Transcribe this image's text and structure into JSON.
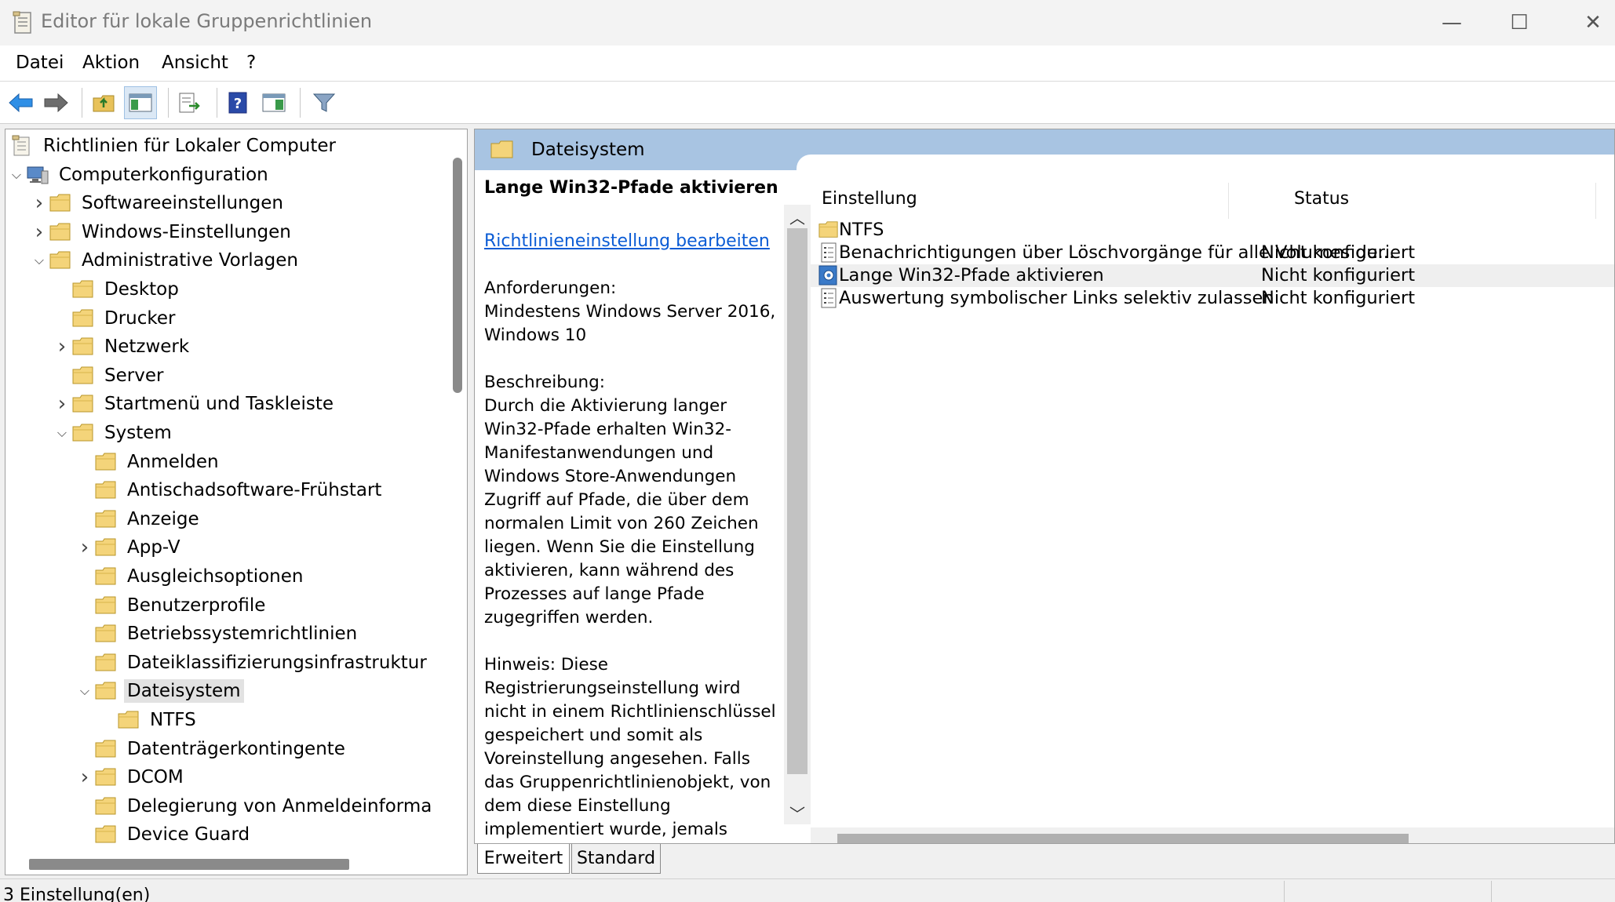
{
  "window": {
    "title": "Editor für lokale Gruppenrichtlinien",
    "minimize": "—",
    "maximize": "☐",
    "close": "✕"
  },
  "menu": [
    "Datei",
    "Aktion",
    "Ansicht",
    "?"
  ],
  "toolbar": {
    "buttons": [
      "back-icon",
      "forward-icon",
      "up-folder-icon",
      "show-hide-tree-icon",
      "export-list-icon",
      "help-icon",
      "properties-icon",
      "filter-icon"
    ]
  },
  "tree": {
    "items": [
      {
        "label": "Richtlinien für Lokaler Computer",
        "icon": "policy-icon",
        "level": 0,
        "expander": ""
      },
      {
        "label": "Computerkonfiguration",
        "icon": "computer-icon",
        "level": 0,
        "expander": "expanded"
      },
      {
        "label": "Softwareeinstellungen",
        "icon": "folder-icon",
        "level": 1,
        "expander": "collapsed"
      },
      {
        "label": "Windows-Einstellungen",
        "icon": "folder-icon",
        "level": 1,
        "expander": "collapsed"
      },
      {
        "label": "Administrative Vorlagen",
        "icon": "folder-icon",
        "level": 1,
        "expander": "expanded"
      },
      {
        "label": "Desktop",
        "icon": "folder-icon",
        "level": 2,
        "expander": ""
      },
      {
        "label": "Drucker",
        "icon": "folder-icon",
        "level": 2,
        "expander": ""
      },
      {
        "label": "Netzwerk",
        "icon": "folder-icon",
        "level": 2,
        "expander": "collapsed"
      },
      {
        "label": "Server",
        "icon": "folder-icon",
        "level": 2,
        "expander": ""
      },
      {
        "label": "Startmenü und Taskleiste",
        "icon": "folder-icon",
        "level": 2,
        "expander": "collapsed"
      },
      {
        "label": "System",
        "icon": "folder-icon",
        "level": 2,
        "expander": "expanded"
      },
      {
        "label": "Anmelden",
        "icon": "folder-icon",
        "level": 3,
        "expander": ""
      },
      {
        "label": "Antischadsoftware-Frühstart",
        "icon": "folder-icon",
        "level": 3,
        "expander": ""
      },
      {
        "label": "Anzeige",
        "icon": "folder-icon",
        "level": 3,
        "expander": ""
      },
      {
        "label": "App-V",
        "icon": "folder-icon",
        "level": 3,
        "expander": "collapsed"
      },
      {
        "label": "Ausgleichsoptionen",
        "icon": "folder-icon",
        "level": 3,
        "expander": ""
      },
      {
        "label": "Benutzerprofile",
        "icon": "folder-icon",
        "level": 3,
        "expander": ""
      },
      {
        "label": "Betriebssystemrichtlinien",
        "icon": "folder-icon",
        "level": 3,
        "expander": ""
      },
      {
        "label": "Dateiklassifizierungsinfrastruktur",
        "icon": "folder-icon",
        "level": 3,
        "expander": ""
      },
      {
        "label": "Dateisystem",
        "icon": "folder-icon",
        "level": 3,
        "expander": "expanded",
        "selected": true
      },
      {
        "label": "NTFS",
        "icon": "folder-icon",
        "level": 4,
        "expander": ""
      },
      {
        "label": "Datenträgerkontingente",
        "icon": "folder-icon",
        "level": 3,
        "expander": ""
      },
      {
        "label": "DCOM",
        "icon": "folder-icon",
        "level": 3,
        "expander": "collapsed"
      },
      {
        "label": "Delegierung von Anmeldeinforma",
        "icon": "folder-icon",
        "level": 3,
        "expander": ""
      },
      {
        "label": "Device Guard",
        "icon": "folder-icon",
        "level": 3,
        "expander": ""
      }
    ]
  },
  "header": {
    "title": "Dateisystem"
  },
  "description": {
    "policy_title": "Lange Win32-Pfade aktivieren",
    "edit_link": "Richtlinieneinstellung bearbeiten",
    "text": "Anforderungen:\nMindestens Windows Server 2016, Windows 10\n\nBeschreibung:\nDurch die Aktivierung langer Win32-Pfade erhalten Win32-Manifestanwendungen und Windows Store-Anwendungen Zugriff auf Pfade, die über dem normalen Limit von 260 Zeichen liegen. Wenn Sie die Einstellung aktivieren, kann während des Prozesses auf lange Pfade zugegriffen werden.\n\nHinweis: Diese Registrierungseinstellung wird nicht in einem Richtlinienschlüssel gespeichert und somit als Voreinstellung angesehen. Falls das Gruppenrichtlinienobjekt, von dem diese Einstellung implementiert wurde, jemals"
  },
  "list": {
    "columns": [
      "Einstellung",
      "Status"
    ],
    "rows": [
      {
        "name": "NTFS",
        "status": "",
        "icon": "folder-icon"
      },
      {
        "name": "Benachrichtigungen über Löschvorgänge für alle Volumes de...",
        "status": "Nicht konfiguriert",
        "icon": "setting-icon"
      },
      {
        "name": "Lange Win32-Pfade aktivieren",
        "status": "Nicht konfiguriert",
        "icon": "setting-selected-icon",
        "highlight": true
      },
      {
        "name": "Auswertung symbolischer Links selektiv zulassen",
        "status": "Nicht konfiguriert",
        "icon": "setting-icon"
      }
    ]
  },
  "tabs": [
    "Erweitert",
    "Standard"
  ],
  "statusbar": {
    "text": "3 Einstellung(en)"
  }
}
